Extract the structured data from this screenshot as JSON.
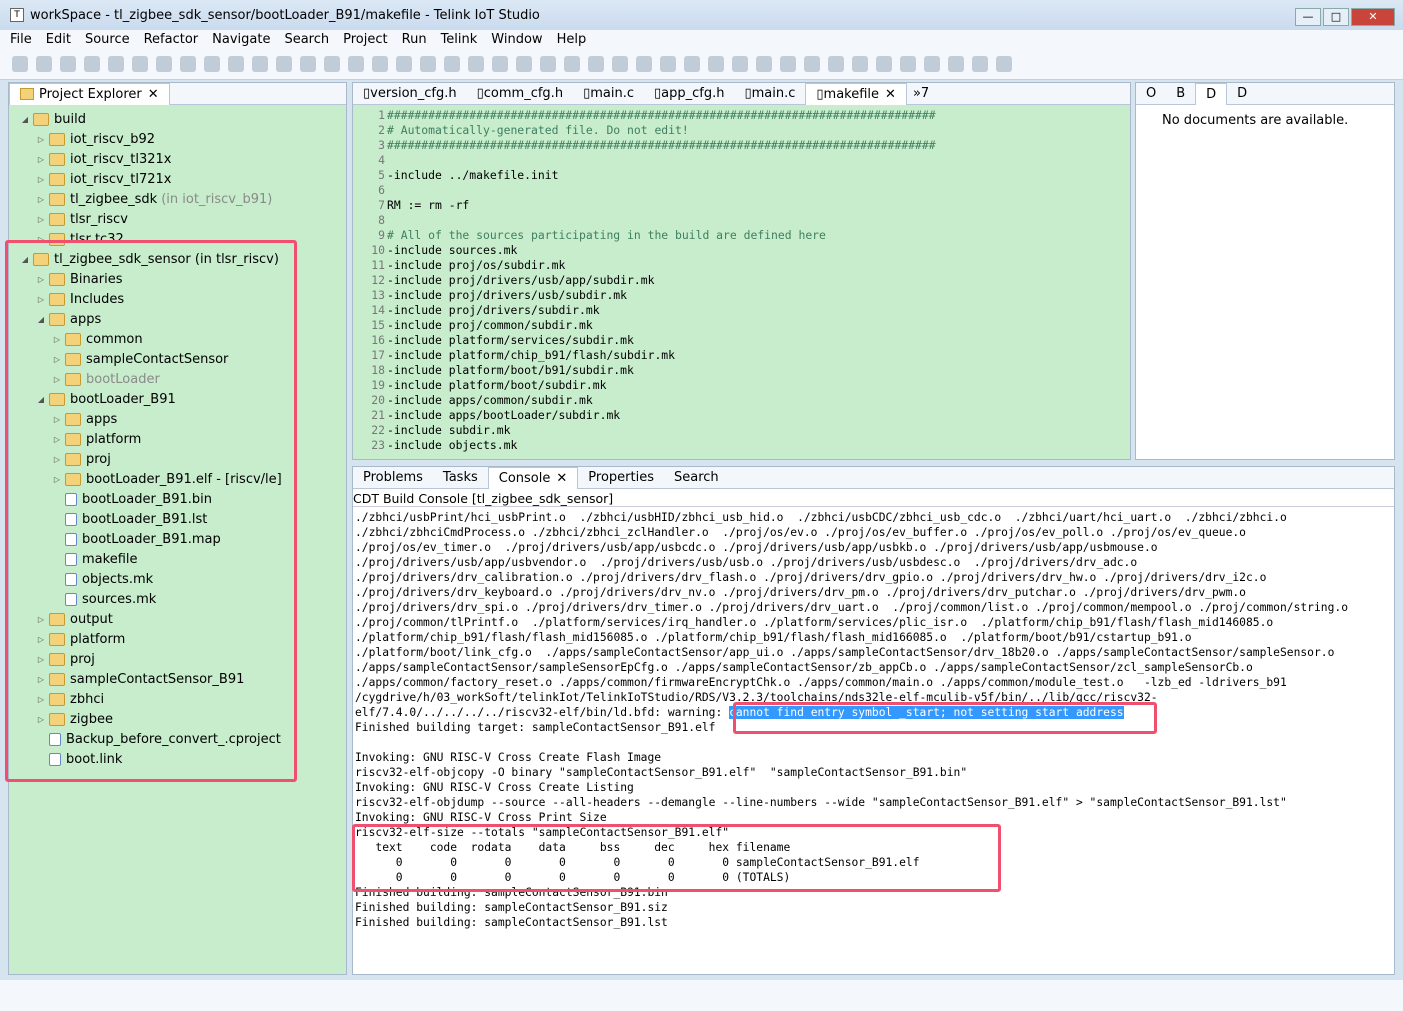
{
  "window": {
    "title": "workSpace - tl_zigbee_sdk_sensor/bootLoader_B91/makefile - Telink IoT Studio",
    "minimize": "—",
    "maximize": "□",
    "close": "✕"
  },
  "menu": [
    "File",
    "Edit",
    "Source",
    "Refactor",
    "Navigate",
    "Search",
    "Project",
    "Run",
    "Telink",
    "Window",
    "Help"
  ],
  "explorer": {
    "title": "Project Explorer",
    "items": [
      {
        "label": "build",
        "depth": 0,
        "exp": "open"
      },
      {
        "label": "iot_riscv_b92",
        "depth": 1,
        "exp": "closed"
      },
      {
        "label": "iot_riscv_tl321x",
        "depth": 1,
        "exp": "closed"
      },
      {
        "label": "iot_riscv_tl721x",
        "depth": 1,
        "exp": "closed"
      },
      {
        "label": "tl_zigbee_sdk",
        "suffix": "(in iot_riscv_b91)",
        "depth": 1,
        "exp": "closed"
      },
      {
        "label": "tlsr_riscv",
        "depth": 1,
        "exp": "closed"
      },
      {
        "label": "tlsr tc32",
        "depth": 1,
        "exp": "closed"
      },
      {
        "label": "tl_zigbee_sdk_sensor (in tlsr_riscv)",
        "depth": 0,
        "exp": "open"
      },
      {
        "label": "Binaries",
        "depth": 1,
        "exp": "closed"
      },
      {
        "label": "Includes",
        "depth": 1,
        "exp": "closed"
      },
      {
        "label": "apps",
        "depth": 1,
        "exp": "open"
      },
      {
        "label": "common",
        "depth": 2,
        "exp": "closed"
      },
      {
        "label": "sampleContactSensor",
        "depth": 2,
        "exp": "closed"
      },
      {
        "label": "bootLoader",
        "depth": 2,
        "exp": "closed",
        "gray": true
      },
      {
        "label": "bootLoader_B91",
        "depth": 1,
        "exp": "open"
      },
      {
        "label": "apps",
        "depth": 2,
        "exp": "closed"
      },
      {
        "label": "platform",
        "depth": 2,
        "exp": "closed"
      },
      {
        "label": "proj",
        "depth": 2,
        "exp": "closed"
      },
      {
        "label": "bootLoader_B91.elf - [riscv/le]",
        "depth": 2,
        "exp": "closed"
      },
      {
        "label": "bootLoader_B91.bin",
        "depth": 2,
        "file": true
      },
      {
        "label": "bootLoader_B91.lst",
        "depth": 2,
        "file": true
      },
      {
        "label": "bootLoader_B91.map",
        "depth": 2,
        "file": true
      },
      {
        "label": "makefile",
        "depth": 2,
        "file": true
      },
      {
        "label": "objects.mk",
        "depth": 2,
        "file": true
      },
      {
        "label": "sources.mk",
        "depth": 2,
        "file": true
      },
      {
        "label": "output",
        "depth": 1,
        "exp": "closed"
      },
      {
        "label": "platform",
        "depth": 1,
        "exp": "closed"
      },
      {
        "label": "proj",
        "depth": 1,
        "exp": "closed"
      },
      {
        "label": "sampleContactSensor_B91",
        "depth": 1,
        "exp": "closed"
      },
      {
        "label": "zbhci",
        "depth": 1,
        "exp": "closed"
      },
      {
        "label": "zigbee",
        "depth": 1,
        "exp": "closed"
      },
      {
        "label": "Backup_before_convert_.cproject",
        "depth": 1,
        "file": true
      },
      {
        "label": "boot.link",
        "depth": 1,
        "file": true
      }
    ]
  },
  "editor": {
    "tabs": [
      "version_cfg.h",
      "comm_cfg.h",
      "main.c",
      "app_cfg.h",
      "main.c",
      "makefile"
    ],
    "active": "makefile",
    "overflow": "»7",
    "lines": [
      "################################################################################",
      "# Automatically-generated file. Do not edit!",
      "################################################################################",
      "",
      "-include ../makefile.init",
      "",
      "RM := rm -rf",
      "",
      "# All of the sources participating in the build are defined here",
      "-include sources.mk",
      "-include proj/os/subdir.mk",
      "-include proj/drivers/usb/app/subdir.mk",
      "-include proj/drivers/usb/subdir.mk",
      "-include proj/drivers/subdir.mk",
      "-include proj/common/subdir.mk",
      "-include platform/services/subdir.mk",
      "-include platform/chip_b91/flash/subdir.mk",
      "-include platform/boot/b91/subdir.mk",
      "-include platform/boot/subdir.mk",
      "-include apps/common/subdir.mk",
      "-include apps/bootLoader/subdir.mk",
      "-include subdir.mk",
      "-include objects.mk"
    ]
  },
  "outline": {
    "tabs": [
      "O",
      "B",
      "D",
      "D"
    ],
    "message": "No documents are available."
  },
  "console": {
    "tabs": [
      "Problems",
      "Tasks",
      "Console",
      "Properties",
      "Search"
    ],
    "active": "Console",
    "header": "CDT Build Console [tl_zigbee_sdk_sensor]",
    "lines": [
      "./zbhci/usbPrint/hci_usbPrint.o  ./zbhci/usbHID/zbhci_usb_hid.o  ./zbhci/usbCDC/zbhci_usb_cdc.o  ./zbhci/uart/hci_uart.o  ./zbhci/zbhci.o",
      "./zbhci/zbhciCmdProcess.o ./zbhci/zbhci_zclHandler.o  ./proj/os/ev.o ./proj/os/ev_buffer.o ./proj/os/ev_poll.o ./proj/os/ev_queue.o",
      "./proj/os/ev_timer.o  ./proj/drivers/usb/app/usbcdc.o ./proj/drivers/usb/app/usbkb.o ./proj/drivers/usb/app/usbmouse.o",
      "./proj/drivers/usb/app/usbvendor.o  ./proj/drivers/usb/usb.o ./proj/drivers/usb/usbdesc.o  ./proj/drivers/drv_adc.o",
      "./proj/drivers/drv_calibration.o ./proj/drivers/drv_flash.o ./proj/drivers/drv_gpio.o ./proj/drivers/drv_hw.o ./proj/drivers/drv_i2c.o",
      "./proj/drivers/drv_keyboard.o ./proj/drivers/drv_nv.o ./proj/drivers/drv_pm.o ./proj/drivers/drv_putchar.o ./proj/drivers/drv_pwm.o",
      "./proj/drivers/drv_spi.o ./proj/drivers/drv_timer.o ./proj/drivers/drv_uart.o  ./proj/common/list.o ./proj/common/mempool.o ./proj/common/string.o",
      "./proj/common/tlPrintf.o  ./platform/services/irq_handler.o ./platform/services/plic_isr.o  ./platform/chip_b91/flash/flash_mid146085.o",
      "./platform/chip_b91/flash/flash_mid156085.o ./platform/chip_b91/flash/flash_mid166085.o  ./platform/boot/b91/cstartup_b91.o",
      "./platform/boot/link_cfg.o  ./apps/sampleContactSensor/app_ui.o ./apps/sampleContactSensor/drv_18b20.o ./apps/sampleContactSensor/sampleSensor.o",
      "./apps/sampleContactSensor/sampleSensorEpCfg.o ./apps/sampleContactSensor/zb_appCb.o ./apps/sampleContactSensor/zcl_sampleSensorCb.o",
      "./apps/common/factory_reset.o ./apps/common/firmwareEncryptChk.o ./apps/common/main.o ./apps/common/module_test.o   -lzb_ed -ldrivers_b91",
      "/cygdrive/h/03_workSoft/telinkIot/TelinkIoTStudio/RDS/V3.2.3/toolchains/nds32le-elf-mculib-v5f/bin/../lib/gcc/riscv32-"
    ],
    "warning_prefix": "elf/7.4.0/../../../../riscv32-elf/bin/ld.bfd: warning: ",
    "warning_selected": "cannot find entry symbol _start; not setting start address",
    "lines2": [
      "Finished building target: sampleContactSensor_B91.elf",
      "",
      "Invoking: GNU RISC-V Cross Create Flash Image",
      "riscv32-elf-objcopy -O binary \"sampleContactSensor_B91.elf\"  \"sampleContactSensor_B91.bin\"",
      "Invoking: GNU RISC-V Cross Create Listing",
      "riscv32-elf-objdump --source --all-headers --demangle --line-numbers --wide \"sampleContactSensor_B91.elf\" > \"sampleContactSensor_B91.lst\"",
      "Invoking: GNU RISC-V Cross Print Size",
      "riscv32-elf-size --totals \"sampleContactSensor_B91.elf\"",
      "   text    code  rodata    data     bss     dec     hex filename",
      "      0       0       0       0       0       0       0 sampleContactSensor_B91.elf",
      "      0       0       0       0       0       0       0 (TOTALS)",
      "Finished building: sampleContactSensor_B91.bin",
      "Finished building: sampleContactSensor_B91.siz",
      "Finished building: sampleContactSensor_B91.lst"
    ]
  },
  "colors": {
    "editor_bg": "#c7edcc",
    "highlight_box": "#f0506e",
    "selection": "#3399ff"
  }
}
